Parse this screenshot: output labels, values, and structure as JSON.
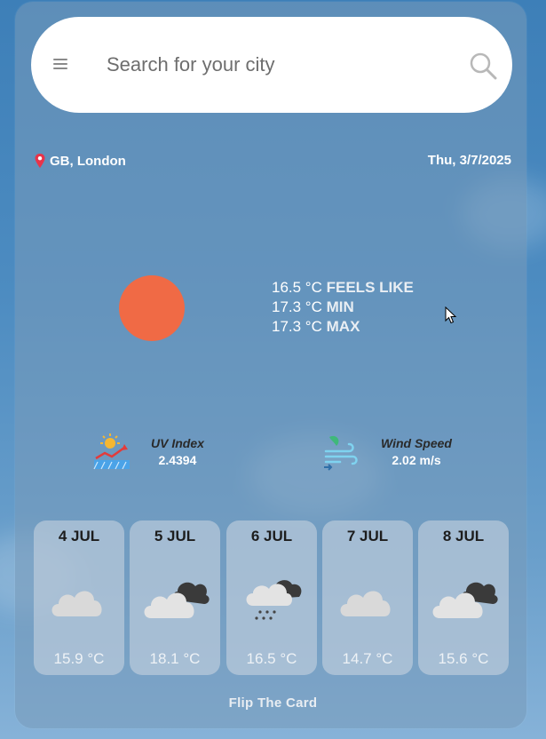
{
  "search": {
    "placeholder": "Search for your city"
  },
  "location": {
    "text": "GB, London"
  },
  "date": "Thu, 3/7/2025",
  "current": {
    "rows": [
      {
        "value": "16.5 °C",
        "label": "FEELS LIKE"
      },
      {
        "value": "17.3 °C",
        "label": "MIN"
      },
      {
        "value": "17.3 °C",
        "label": "MAX"
      }
    ]
  },
  "stats": {
    "uv": {
      "label": "UV Index",
      "value": "2.4394",
      "icon": "uv-index-icon"
    },
    "wind": {
      "label": "Wind Speed",
      "value": "2.02 m/s",
      "icon": "wind-speed-icon"
    }
  },
  "forecast": [
    {
      "day": "4 JUL",
      "temp": "15.9 °C",
      "icon": "cloud-icon"
    },
    {
      "day": "5 JUL",
      "temp": "18.1 °C",
      "icon": "dark-cloud-icon"
    },
    {
      "day": "6 JUL",
      "temp": "16.5 °C",
      "icon": "rain-cloud-icon"
    },
    {
      "day": "7 JUL",
      "temp": "14.7 °C",
      "icon": "cloud-icon"
    },
    {
      "day": "8 JUL",
      "temp": "15.6 °C",
      "icon": "dark-cloud-icon"
    }
  ],
  "footer": {
    "flip_label": "Flip The Card"
  },
  "colors": {
    "sun": "#f06a45",
    "background": "#4d8cc1"
  }
}
